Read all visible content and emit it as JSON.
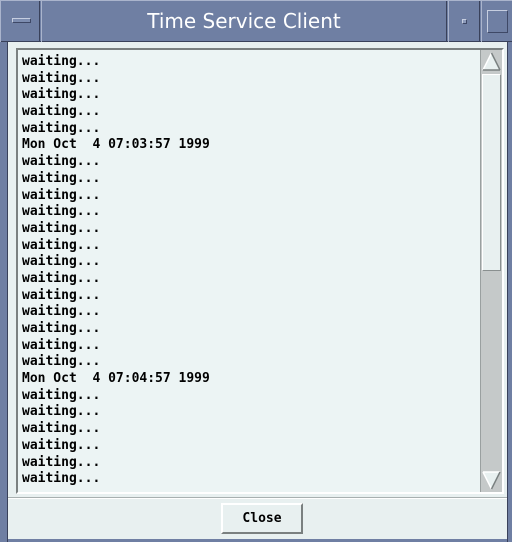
{
  "window": {
    "title": "Time Service Client"
  },
  "log": {
    "lines": [
      "waiting...",
      "waiting...",
      "waiting...",
      "waiting...",
      "waiting...",
      "Mon Oct  4 07:03:57 1999",
      "waiting...",
      "waiting...",
      "waiting...",
      "waiting...",
      "waiting...",
      "waiting...",
      "waiting...",
      "waiting...",
      "waiting...",
      "waiting...",
      "waiting...",
      "waiting...",
      "waiting...",
      "Mon Oct  4 07:04:57 1999",
      "waiting...",
      "waiting...",
      "waiting...",
      "waiting...",
      "waiting...",
      "waiting...",
      "waiting...",
      "waiting..."
    ]
  },
  "scrollbar": {
    "position_fraction": 0.0,
    "visible_fraction": 0.5
  },
  "buttons": {
    "close_label": "Close"
  },
  "colors": {
    "titlebar": "#6f7fa3",
    "title_text": "#ffffff",
    "window_bg": "#e8f0f0",
    "text": "#000000"
  },
  "icons": {
    "window_menu": "window-menu-icon",
    "minimize": "minimize-icon",
    "maximize": "maximize-icon",
    "scroll_up": "arrow-up-icon",
    "scroll_down": "arrow-down-icon"
  }
}
